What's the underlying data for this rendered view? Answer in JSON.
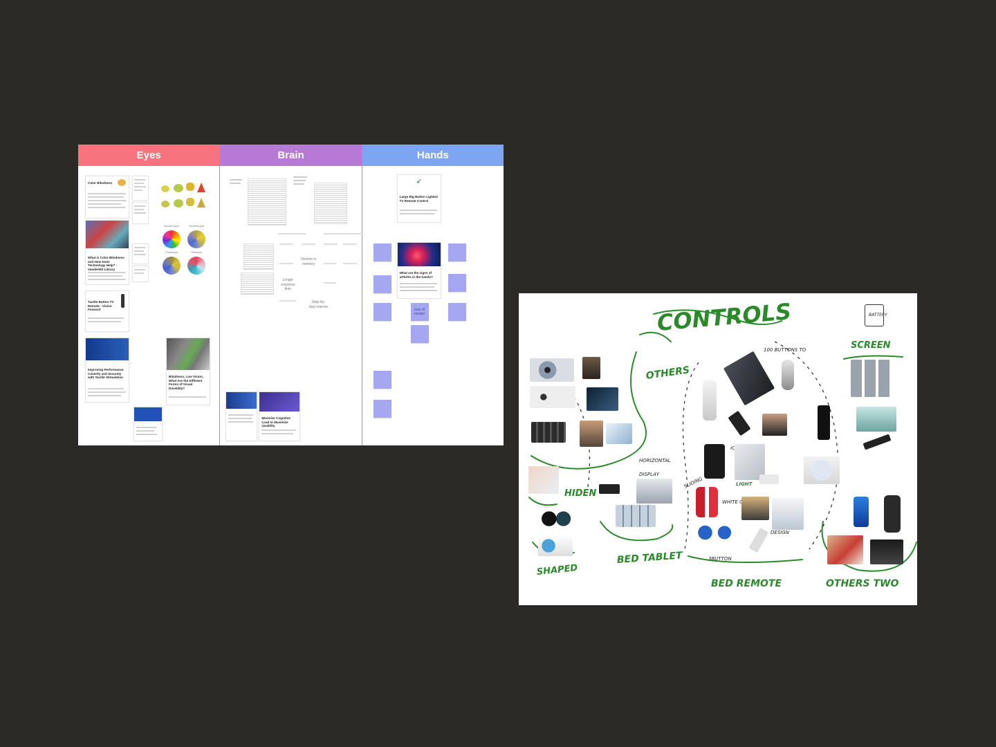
{
  "board": {
    "columns": [
      {
        "title": "Eyes",
        "color": "#f7737e"
      },
      {
        "title": "Brain",
        "color": "#b67ad6"
      },
      {
        "title": "Hands",
        "color": "#7ea5f2"
      }
    ],
    "eyes": {
      "card1_title": "Color Blindness",
      "card2_title": "What is Color Blindness and How Does Technology Help? - Vanderbilt Library",
      "pie_labels": [
        "Normal vision",
        "Deuteranopia",
        "Protanopia",
        "Tritanopia"
      ],
      "card3_title": "Tactile Button TV Remote - Vision Forward",
      "card4_title": "Improving Performance Covertly and Securely with Tactile Stimulation",
      "card5_title": "Blindness, Low Vision, What Are the Different Forms of Visual Disability?"
    },
    "brain": {
      "card1_title": "Minimize Cognitive Load to Maximize Usability",
      "notes": [
        "Decline in memory",
        "Longer response time",
        "Step-by-step manner"
      ]
    },
    "hands": {
      "card1_title": "Large Big Button Lighted TV Remote Control",
      "card2_title": "What are the signs of arthritis in the hands?",
      "stickies": [
        "loss of motion"
      ]
    }
  },
  "sketch": {
    "title": "CONTROLS",
    "labels": {
      "battery": "BATTERY",
      "screen": "SCREEN",
      "others": "OTHERS",
      "buttons": "100 BUTTONS TO",
      "hiden": "HIDEN",
      "shaped": "SHAPED",
      "bed_tablet": "BED TABLET",
      "bed_remote": "BED REMOTE",
      "others_two": "OTHERS TWO",
      "light": "LIGHT",
      "icons": "ICONS",
      "white_color": "WHITE COLOR",
      "design": "DESIGN",
      "3button": "3BUTTON",
      "sliding": "SLIDING",
      "horizontal": "HORIZONTAL",
      "display": "DISPLAY"
    }
  }
}
